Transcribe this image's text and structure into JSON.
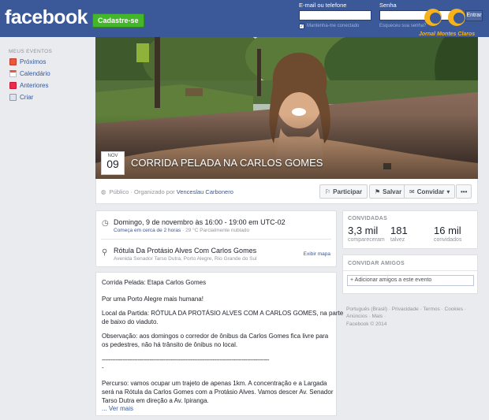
{
  "topbar": {
    "logo": "facebook",
    "signup": "Cadastre-se",
    "email_label": "E-mail ou telefone",
    "password_label": "Senha",
    "remember": "Mantenha-me conectado",
    "forgot": "Esqueceu sua senha?",
    "login_button": "Entrar"
  },
  "watermark": {
    "text": "Jornal Montes Claros"
  },
  "nav": {
    "heading": "MEUS EVENTOS",
    "items": [
      {
        "label": "Próximos",
        "icon": "calendar-upcoming-icon",
        "color": "#e9573f"
      },
      {
        "label": "Calendário",
        "icon": "calendar-icon",
        "color": "#ffffff"
      },
      {
        "label": "Anteriores",
        "icon": "past-events-icon",
        "color": "#f02849"
      },
      {
        "label": "Criar",
        "icon": "create-event-icon",
        "color": "#8f9aa8"
      }
    ]
  },
  "event": {
    "month": "NOV",
    "day": "09",
    "title": "CORRIDA PELADA NA CARLOS GOMES",
    "privacy": "Público",
    "organized_by": "Organizado por",
    "organizer": "Venceslau Carbonero"
  },
  "actions": {
    "participate": "Participar",
    "save": "Salvar",
    "invite": "Convidar",
    "more": "•••"
  },
  "details": {
    "datetime": "Domingo, 9 de novembro às 16:00 - 19:00 em UTC-02",
    "starts_in": "Começa em cerca de 2 horas",
    "weather": "29 °C Parcialmente nublado",
    "location": "Rótula Da Protásio Alves Com Carlos Gomes",
    "address": "Avenida Senador Tarso Dutra, Porto Alegre, Rio Grande do Sul",
    "map_link": "Exibir mapa"
  },
  "description": {
    "lines": [
      "Corrida Pelada: Etapa Carlos Gomes",
      "Por uma Porto Alegre mais humana!",
      "Local da Partida: RÓTULA DA PROTÁSIO ALVES COM A CARLOS GOMES, na parte",
      "de baixo do viaduto.",
      "Observação: aos domingos o corredor de ônibus da Carlos Gomes fica livre para",
      "os pedestres, não há trânsito de ônibus no local.",
      "--------------------------------------------------------------------------------------------------",
      "-",
      "Percurso: vamos ocupar um trajeto de apenas 1km. A concentração e a Largada",
      "será na Rótula da Carlos Gomes com a Protásio Alves. Vamos descer Av. Senador",
      "Tarso Dutra em direção a Av. Ipiranga."
    ],
    "see_more": "... Ver mais"
  },
  "guests": {
    "heading": "CONVIDADAS",
    "stats": [
      {
        "num": "3,3 mil",
        "label": "compareceram"
      },
      {
        "num": "181",
        "label": "talvez"
      },
      {
        "num": "16 mil",
        "label": "convidados"
      }
    ]
  },
  "invite": {
    "heading": "CONVIDAR AMIGOS",
    "placeholder": "+ Adicionar amigos a este evento"
  },
  "footer": {
    "line1": "Português (Brasil) · Privacidade · Termos · Cookies ·",
    "line2": "Anúncios · Mais ·",
    "line3": "Facebook © 2014"
  }
}
